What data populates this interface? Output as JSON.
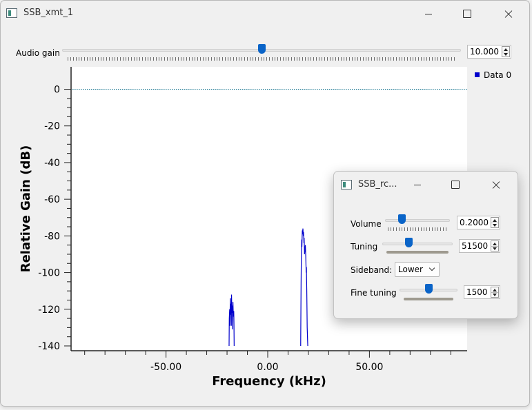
{
  "main_window": {
    "title": "SSB_xmt_1",
    "audio_gain": {
      "label": "Audio gain",
      "value": "10.000",
      "slider_fraction": 0.5
    }
  },
  "chart_data": {
    "type": "line",
    "xlabel": "Frequency (kHz)",
    "ylabel": "Relative Gain (dB)",
    "xlim": [
      -96,
      96
    ],
    "ylim": [
      -140,
      5
    ],
    "x_ticks": [
      -50,
      0,
      50
    ],
    "x_tick_labels": [
      "-50.00",
      "0.00",
      "50.00"
    ],
    "y_ticks": [
      0,
      -20,
      -40,
      -60,
      -80,
      -100,
      -120,
      -140
    ],
    "y_tick_labels": [
      "0",
      "-20",
      "-40",
      "-60",
      "-80",
      "-100",
      "-120",
      "-140"
    ],
    "reference_line_y": 0,
    "legend": {
      "position": "top-right",
      "entries": [
        "Data 0"
      ]
    },
    "series": [
      {
        "name": "Data 0",
        "color": "#0000cc",
        "x": [
          -19.0,
          -18.9,
          -18.7,
          -18.6,
          -18.4,
          -18.3,
          -18.1,
          -17.9,
          -17.8,
          -17.6,
          -17.4,
          -17.3,
          -17.1,
          -16.9,
          -16.7,
          -16.6,
          -16.5,
          16.2,
          16.4,
          16.5,
          16.7,
          16.8,
          17.0,
          17.1,
          17.3,
          17.5,
          17.6,
          17.8,
          17.9,
          18.1,
          18.3,
          18.5,
          18.7,
          18.9,
          19.0,
          19.2,
          19.4,
          19.6,
          19.7
        ],
        "y": [
          -140,
          -125,
          -120,
          -129,
          -114,
          -123,
          -117,
          -129,
          -112,
          -122,
          -118,
          -131,
          -116,
          -124,
          -121,
          -128,
          -140,
          -140,
          -106,
          -94,
          -82,
          -86,
          -77,
          -79,
          -76,
          -80,
          -78,
          -84,
          -81,
          -90,
          -87,
          -85,
          -91,
          -100,
          -97,
          -110,
          -130,
          -137,
          -140
        ]
      }
    ]
  },
  "rx_window": {
    "title": "SSB_rc...",
    "volume": {
      "label": "Volume",
      "value": "0.2000",
      "slider_fraction": 0.23
    },
    "tuning": {
      "label": "Tuning",
      "value": "51500",
      "slider_fraction": 0.36
    },
    "sideband": {
      "label": "Sideband:",
      "selected": "Lower"
    },
    "fine_tuning": {
      "label": "Fine tuning",
      "value": "1500",
      "slider_fraction": 0.5
    }
  },
  "colors": {
    "accent": "#0a64c8",
    "trace": "#0000cc",
    "reference_line": "#0a6e8a"
  },
  "icons": [
    "app-window-icon",
    "minimize-icon",
    "maximize-icon",
    "close-icon",
    "chevron-down-icon",
    "spin-up-icon",
    "spin-down-icon"
  ]
}
